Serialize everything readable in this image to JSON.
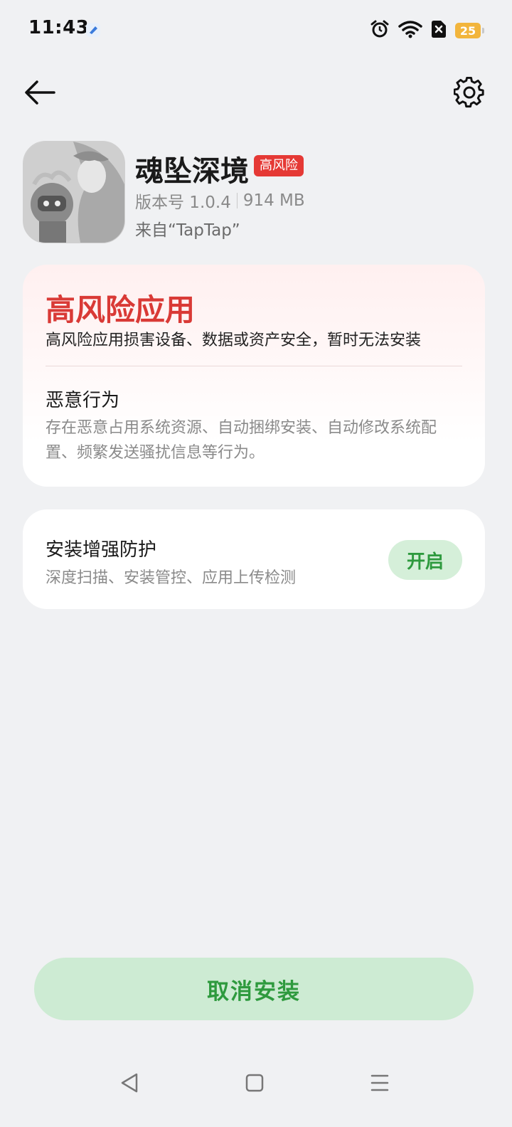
{
  "status_bar": {
    "time": "11:43",
    "battery": "25",
    "icons": [
      "app-notification-icon",
      "alarm-icon",
      "wifi-icon",
      "sim-off-icon",
      "battery-icon"
    ]
  },
  "header": {
    "back_icon": "back-arrow-icon",
    "settings_icon": "gear-icon"
  },
  "app": {
    "name": "魂坠深境",
    "risk_badge": "高风险",
    "version": "版本号 1.0.4",
    "size": "914 MB",
    "source": "来自“TapTap”"
  },
  "risk_card": {
    "title": "高风险应用",
    "description": "高风险应用损害设备、数据或资产安全，暂时无法安装",
    "behavior_title": "恶意行为",
    "behavior_description": "存在恶意占用系统资源、自动捆绑安装、自动修改系统配置、频繁发送骚扰信息等行为。"
  },
  "protection": {
    "title": "安装增强防护",
    "description": "深度扫描、安装管控、应用上传检测",
    "enable_label": "开启"
  },
  "actions": {
    "cancel_label": "取消安装"
  },
  "nav_bar": {
    "icons": [
      "nav-back-icon",
      "nav-home-icon",
      "nav-menu-icon"
    ]
  },
  "colors": {
    "danger": "#d93a36",
    "badge": "#e53935",
    "accent_green": "#2e9a3e",
    "green_bg": "#cdebd3",
    "background": "#f0f1f3"
  }
}
